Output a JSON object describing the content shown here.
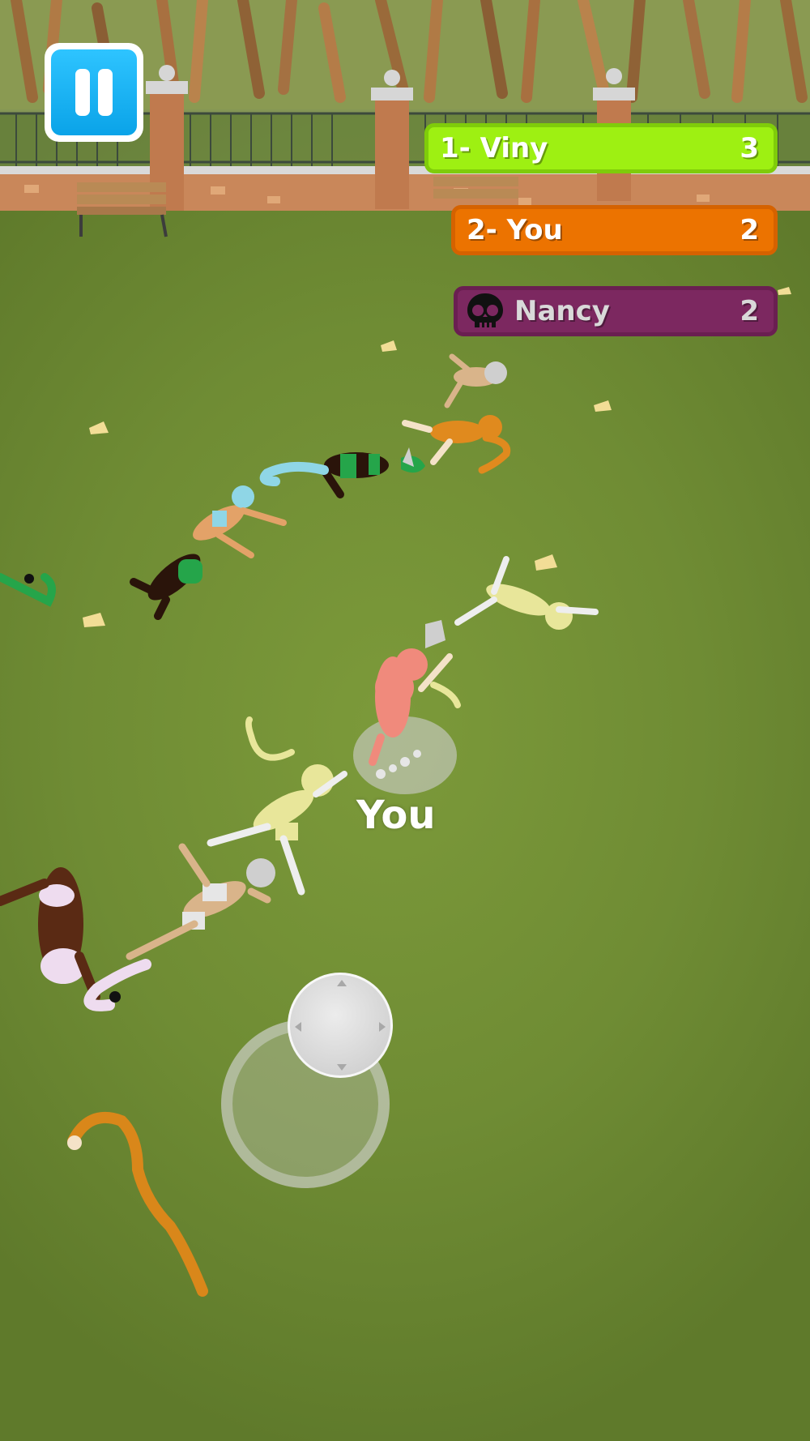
{
  "hud": {
    "pause_icon": "pause-icon"
  },
  "leaderboard": {
    "rows": [
      {
        "label": "1-  Viny",
        "score": "3",
        "color": "#9ef012"
      },
      {
        "label": "2-  You",
        "score": "2",
        "color": "#ec7300"
      }
    ],
    "eliminated": {
      "label": "Nancy",
      "score": "2",
      "icon": "skull-icon",
      "color": "#7c2860"
    }
  },
  "player": {
    "label": "You"
  },
  "joystick": {
    "icon": "joystick-icon"
  },
  "colors": {
    "grass": "#6f8c34",
    "wall": "#c9875a",
    "pause_blue": "#0aa3e8"
  }
}
